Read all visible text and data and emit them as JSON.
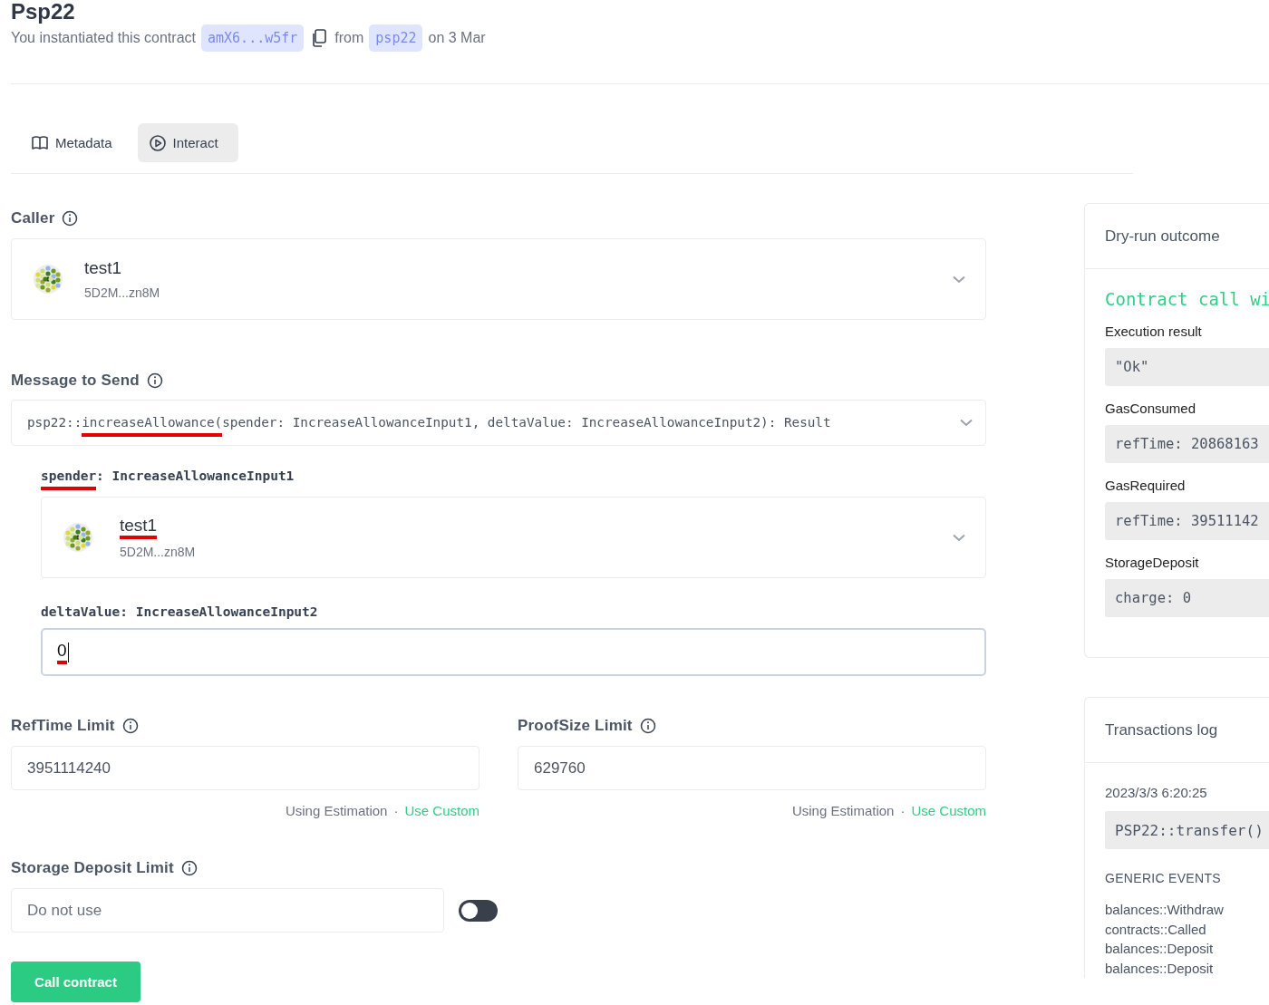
{
  "header": {
    "title": "Psp22",
    "intro": "You instantiated this contract",
    "address": "amX6...w5fr",
    "from": "from",
    "code_name": "psp22",
    "date": "on 3 Mar"
  },
  "tabs": [
    {
      "label": "Metadata",
      "selected": false
    },
    {
      "label": "Interact",
      "selected": true
    }
  ],
  "caller": {
    "label": "Caller",
    "account": {
      "name": "test1",
      "address": "5D2M...zn8M",
      "underlined": false
    }
  },
  "message": {
    "label": "Message to Send",
    "parts": [
      {
        "text": "psp22::",
        "underlined": false
      },
      {
        "text": "increaseAllowance(",
        "underlined": true
      },
      {
        "text": "spender: IncreaseAllowanceInput1, deltaValue: IncreaseAllowanceInput2): Result",
        "underlined": false
      }
    ]
  },
  "args": [
    {
      "kind": "account",
      "name": "spender",
      "type": ": IncreaseAllowanceInput1",
      "name_underlined": true,
      "account": {
        "name": "test1",
        "address": "5D2M...zn8M",
        "underlined": true
      }
    },
    {
      "kind": "text",
      "name": "deltaValue",
      "type": ": IncreaseAllowanceInput2",
      "name_underlined": false,
      "value": "0",
      "value_underlined": true
    }
  ],
  "limits": [
    {
      "label": "RefTime Limit",
      "value": "3951114240",
      "mode": "Using Estimation",
      "separator": "·",
      "action": "Use Custom"
    },
    {
      "label": "ProofSize Limit",
      "value": "629760",
      "mode": "Using Estimation",
      "separator": "·",
      "action": "Use Custom"
    }
  ],
  "storage": {
    "label": "Storage Deposit Limit",
    "placeholder": "Do not use",
    "on": false
  },
  "submit": "Call contract",
  "dry_run": {
    "title": "Dry-run outcome",
    "status": "Contract call wi",
    "fields": [
      {
        "label": "Execution result",
        "value": "\"Ok\""
      },
      {
        "label": "GasConsumed",
        "value": "refTime: 20868163"
      },
      {
        "label": "GasRequired",
        "value": "refTime: 39511142"
      },
      {
        "label": "StorageDeposit",
        "value": "charge: 0"
      }
    ]
  },
  "tx_log": {
    "title": "Transactions log",
    "entries": [
      {
        "time": "2023/3/3 6:20:25",
        "call": "PSP22::transfer()",
        "events_heading": "GENERIC EVENTS",
        "events": [
          "balances::Withdraw",
          "contracts::Called",
          "balances::Deposit",
          "balances::Deposit"
        ]
      }
    ]
  }
}
